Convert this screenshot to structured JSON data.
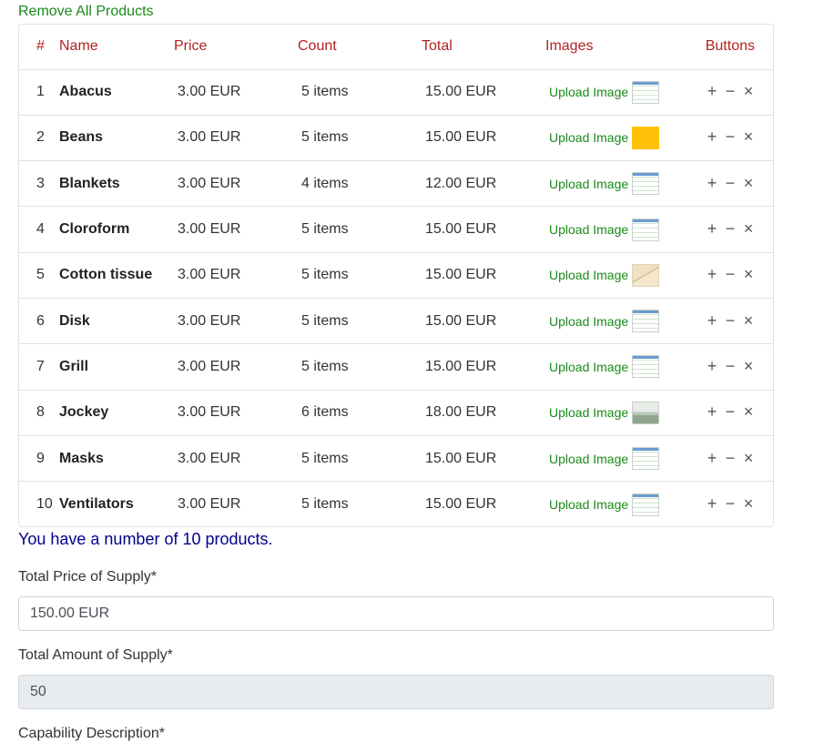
{
  "remove_all_label": "Remove All Products",
  "table": {
    "headers": {
      "num": "#",
      "name": "Name",
      "price": "Price",
      "count": "Count",
      "total": "Total",
      "images": "Images",
      "buttons": "Buttons"
    },
    "upload_label": "Upload Image",
    "rows": [
      {
        "num": "1",
        "name": "Abacus",
        "price": "3.00 EUR",
        "count": "5 items",
        "total": "15.00 EUR",
        "thumb": "screenshot"
      },
      {
        "num": "2",
        "name": "Beans",
        "price": "3.00 EUR",
        "count": "5 items",
        "total": "15.00 EUR",
        "thumb": "yellow"
      },
      {
        "num": "3",
        "name": "Blankets",
        "price": "3.00 EUR",
        "count": "4 items",
        "total": "12.00 EUR",
        "thumb": "screenshot"
      },
      {
        "num": "4",
        "name": "Cloroform",
        "price": "3.00 EUR",
        "count": "5 items",
        "total": "15.00 EUR",
        "thumb": "screenshot"
      },
      {
        "num": "5",
        "name": "Cotton tissue",
        "price": "3.00 EUR",
        "count": "5 items",
        "total": "15.00 EUR",
        "thumb": "sketch"
      },
      {
        "num": "6",
        "name": "Disk",
        "price": "3.00 EUR",
        "count": "5 items",
        "total": "15.00 EUR",
        "thumb": "screenshot"
      },
      {
        "num": "7",
        "name": "Grill",
        "price": "3.00 EUR",
        "count": "5 items",
        "total": "15.00 EUR",
        "thumb": "screenshot"
      },
      {
        "num": "8",
        "name": "Jockey",
        "price": "3.00 EUR",
        "count": "6 items",
        "total": "18.00 EUR",
        "thumb": "photo"
      },
      {
        "num": "9",
        "name": "Masks",
        "price": "3.00 EUR",
        "count": "5 items",
        "total": "15.00 EUR",
        "thumb": "screenshot"
      },
      {
        "num": "10",
        "name": "Ventilators",
        "price": "3.00 EUR",
        "count": "5 items",
        "total": "15.00 EUR",
        "thumb": "screenshot"
      }
    ],
    "row_actions": {
      "plus": "+",
      "minus": "−",
      "remove": "×"
    }
  },
  "summary_text": "You have a number of 10 products.",
  "form": {
    "total_price_label": "Total Price of Supply*",
    "total_price_value": "150.00 EUR",
    "total_amount_label": "Total Amount of Supply*",
    "total_amount_value": "50",
    "capability_label": "Capability Description*"
  },
  "colors": {
    "accent_green": "#1a8a1a",
    "header_red": "#b22222",
    "summary_navy": "#00008b"
  }
}
